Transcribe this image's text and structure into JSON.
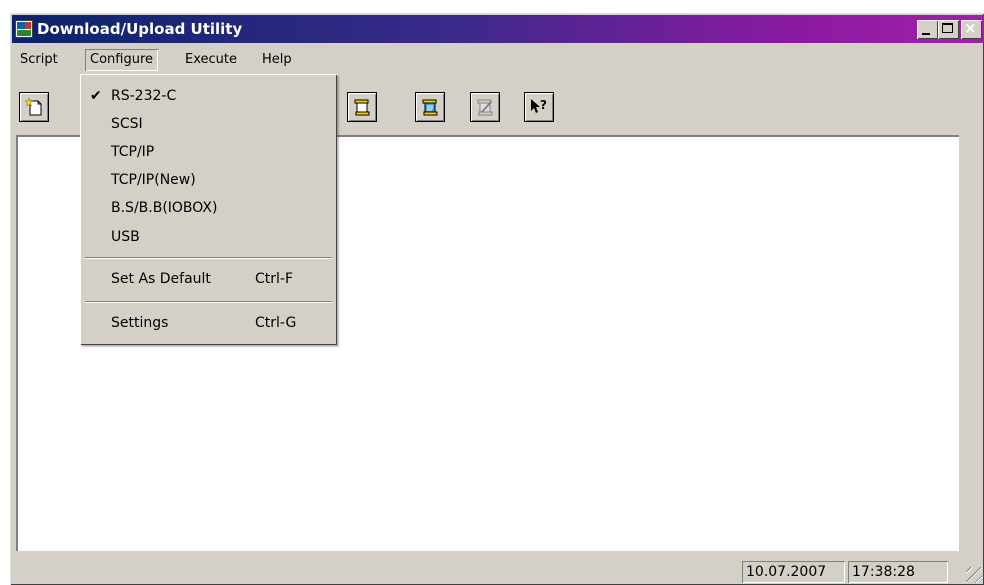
{
  "window": {
    "title": "Download/Upload Utility"
  },
  "menubar": {
    "items": [
      "Script",
      "Configure",
      "Execute",
      "Help"
    ],
    "active": "Configure"
  },
  "toolbar": {
    "buttons": [
      "new-document-icon",
      "open-script-icon",
      "save-script-icon",
      "edit-script-icon",
      "context-help-icon"
    ]
  },
  "configure_menu": {
    "items": [
      {
        "label": "RS-232-C",
        "checked": true
      },
      {
        "label": "SCSI"
      },
      {
        "label": "TCP/IP"
      },
      {
        "label": "TCP/IP(New)"
      },
      {
        "label": "B.S/B.B(IOBOX)"
      },
      {
        "label": "USB"
      },
      {
        "label": "Set As Default",
        "shortcut": "Ctrl-F"
      },
      {
        "label": "Settings",
        "shortcut": "Ctrl-G"
      }
    ],
    "check_glyph": "✔"
  },
  "statusbar": {
    "date": "10.07.2007",
    "time": "17:38:28"
  }
}
